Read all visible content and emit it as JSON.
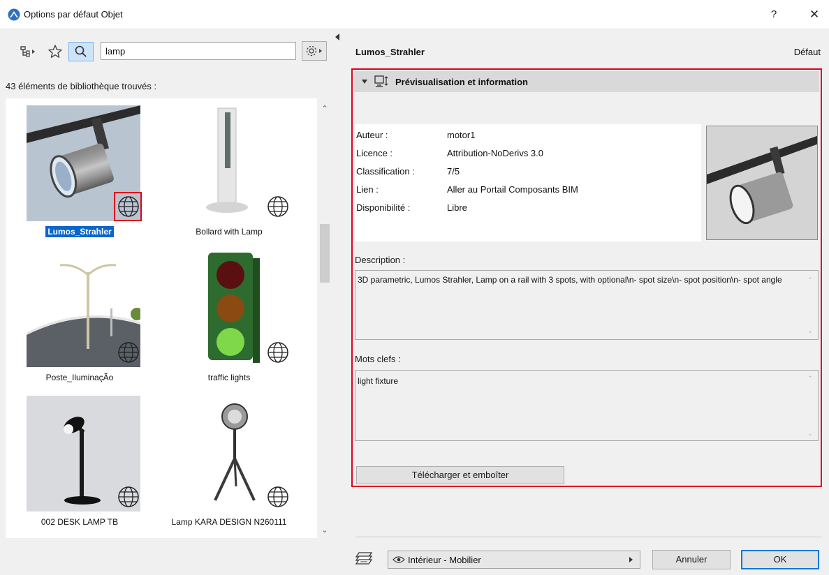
{
  "window": {
    "title": "Options par défaut Objet",
    "help": "?",
    "close": "✕"
  },
  "library": {
    "search_value": "lamp",
    "found_label": "43 éléments de bibliothèque trouvés :",
    "items": [
      {
        "name": "Lumos_Strahler",
        "selected": true
      },
      {
        "name": "Bollard with Lamp"
      },
      {
        "name": "Poste_IluminaçÃo"
      },
      {
        "name": "traffic lights"
      },
      {
        "name": "002 DESK LAMP TB"
      },
      {
        "name": "Lamp KARA DESIGN N260111"
      }
    ]
  },
  "detail": {
    "object_name": "Lumos_Strahler",
    "default_label": "Défaut",
    "section_title": "Prévisualisation et information",
    "properties": [
      {
        "key": "Auteur :",
        "value": "motor1"
      },
      {
        "key": "Licence :",
        "value": "Attribution-NoDerivs 3.0"
      },
      {
        "key": "Classification :",
        "value": "7/5"
      },
      {
        "key": "Lien :",
        "value": "Aller au Portail Composants BIM"
      },
      {
        "key": "Disponibilité :",
        "value": "Libre"
      }
    ],
    "description_label": "Description :",
    "description": "3D parametric, Lumos Strahler, Lamp on a rail with 3 spots, with optional\\n- spot size\\n- spot position\\n- spot angle",
    "keywords_label": "Mots clefs :",
    "keywords": "light fixture",
    "download_button": "Télécharger et emboîter"
  },
  "footer": {
    "category": "Intérieur - Mobilier",
    "cancel": "Annuler",
    "ok": "OK"
  },
  "colors": {
    "highlight_red": "#e0001b",
    "selection_blue": "#0a66cc",
    "ok_border": "#0078d7"
  }
}
